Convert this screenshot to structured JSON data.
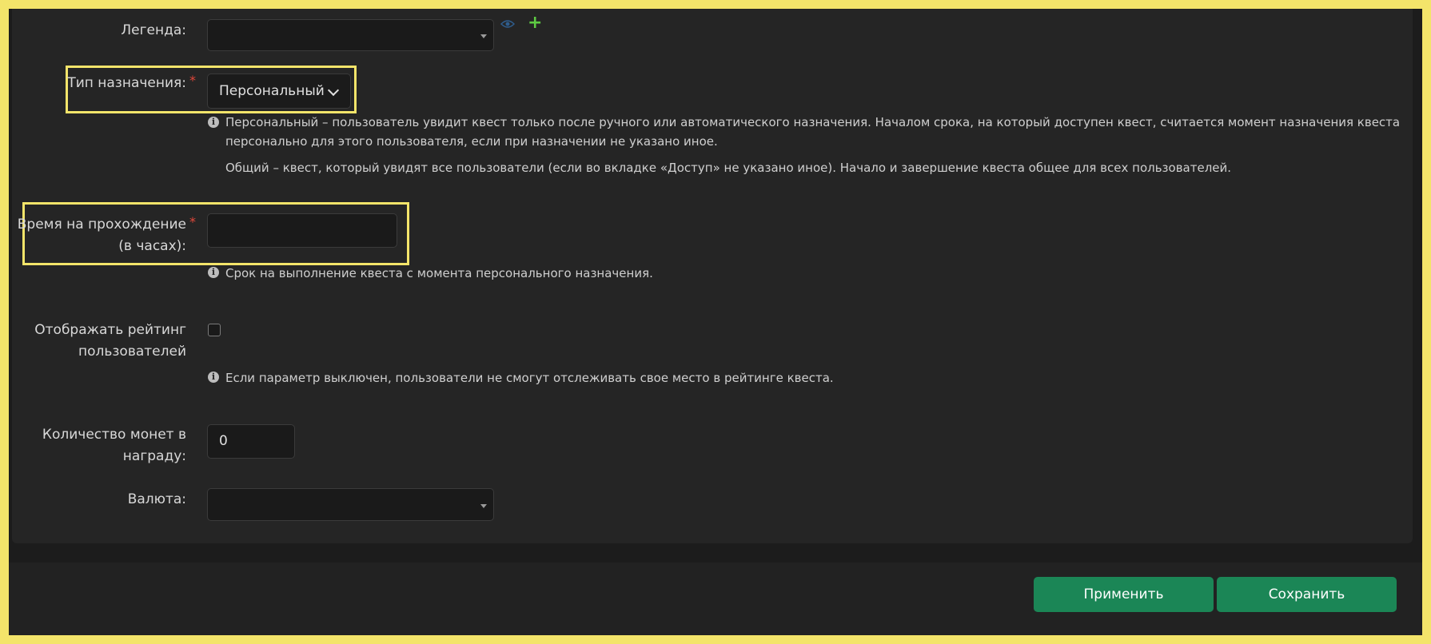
{
  "form": {
    "legend": {
      "label": "Легенда:",
      "value": "",
      "eye_icon": "eye-icon",
      "plus_icon": "plus-icon"
    },
    "assignment_type": {
      "label": "Тип назначения:",
      "required_mark": "*",
      "value": "Персональный",
      "hint_personal": "Персональный – пользователь увидит квест только после ручного или автоматического назначения. Началом срока, на который доступен квест, считается момент назначения квеста персонально для этого пользователя, если при назначении не указано иное.",
      "hint_common": "Общий – квест, который увидят все пользователи (если во вкладке «Доступ» не указано иное). Начало и завершение квеста общее для всех пользователей."
    },
    "time_limit": {
      "label_line1": "Время на прохождение",
      "label_line2": "(в часах):",
      "required_mark": "*",
      "value": "",
      "hint": "Срок на выполнение квеста с момента персонального назначения."
    },
    "show_rating": {
      "label_line1": "Отображать рейтинг",
      "label_line2": "пользователей",
      "checked": false,
      "hint": "Если параметр выключен, пользователи не смогут отслеживать свое место в рейтинге квеста."
    },
    "coins_reward": {
      "label_line1": "Количество монет в",
      "label_line2": "награду:",
      "value": "0"
    },
    "currency": {
      "label": "Валюта:",
      "value": ""
    }
  },
  "footer": {
    "apply_label": "Применить",
    "save_label": "Сохранить"
  },
  "colors": {
    "highlight": "#f3e46a",
    "primary_button": "#1b8656",
    "required": "#e0473a",
    "plus": "#5ecb43"
  }
}
